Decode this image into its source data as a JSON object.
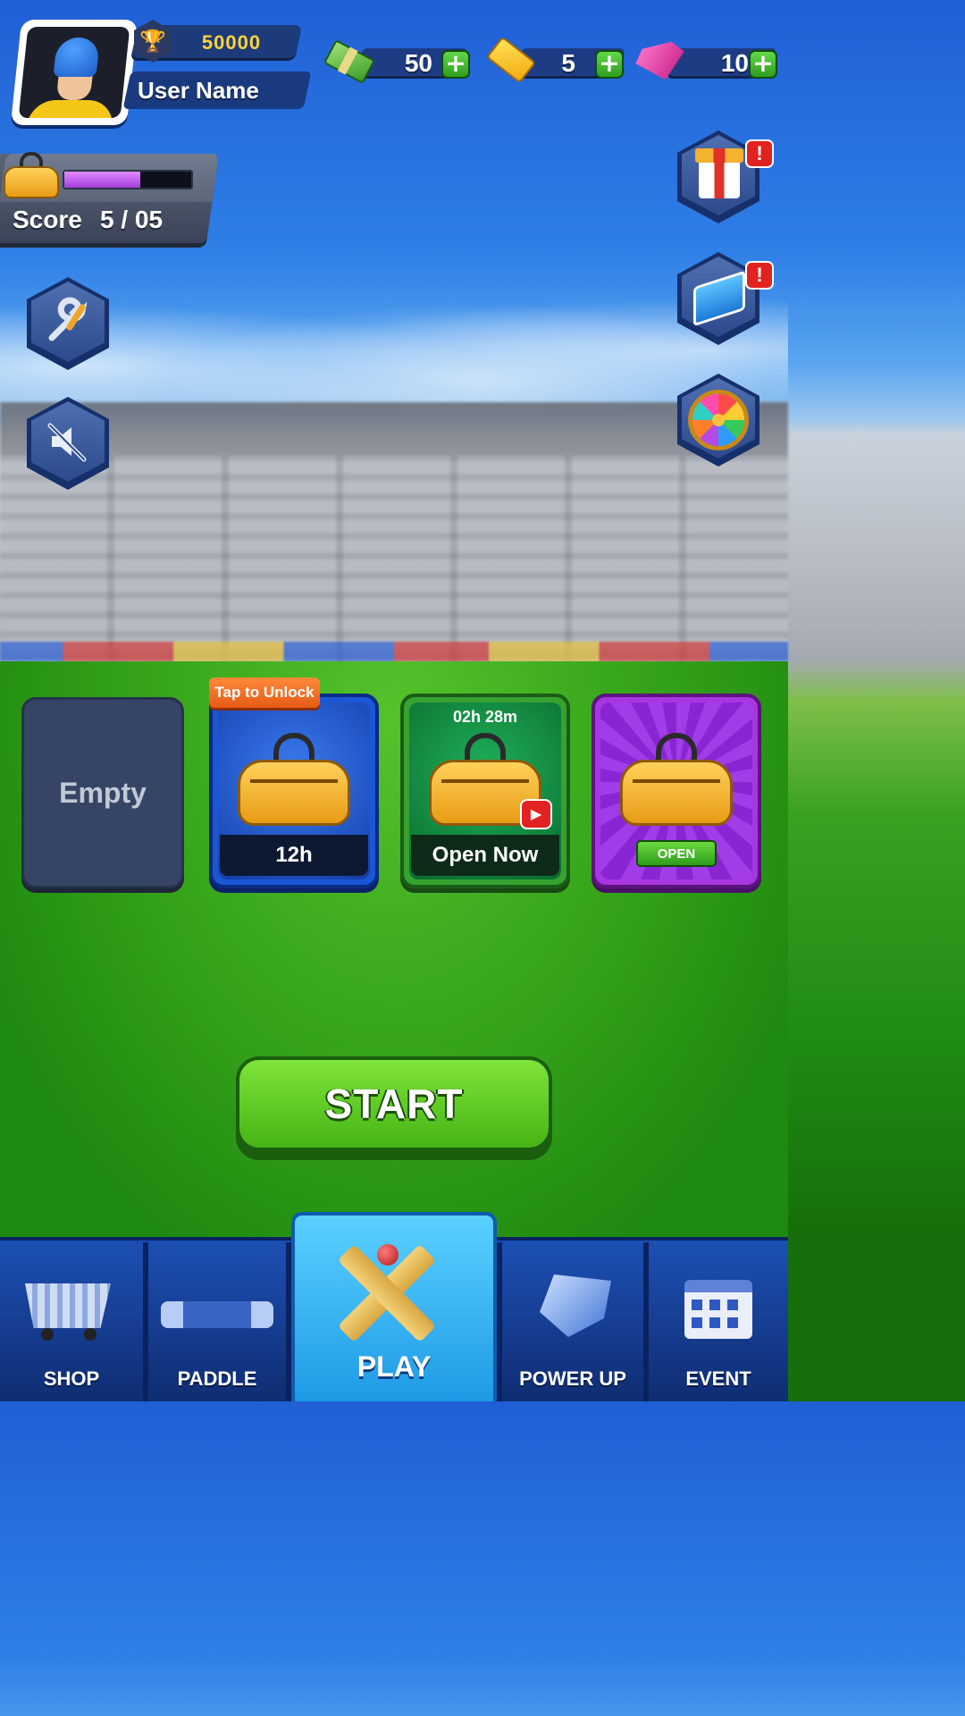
{
  "player": {
    "trophies": "50000",
    "username": "User Name",
    "avatar_icon": "cricketer-avatar"
  },
  "currencies": [
    {
      "name": "cash",
      "icon": "cash-icon",
      "amount": "50",
      "plus": "+"
    },
    {
      "name": "tickets",
      "icon": "ticket-icon",
      "amount": "5",
      "plus": "+"
    },
    {
      "name": "gems",
      "icon": "gem-icon",
      "amount": "10",
      "plus": "+"
    }
  ],
  "score_panel": {
    "label": "Score",
    "value": "5 / 05",
    "progress": 0.6,
    "progress_color": "#c25ff0"
  },
  "left_buttons": [
    {
      "name": "settings",
      "icon": "wrench-icon"
    },
    {
      "name": "sound",
      "icon": "mute-icon"
    }
  ],
  "right_buttons": [
    {
      "name": "gift",
      "icon": "gift-icon",
      "alert": "!"
    },
    {
      "name": "book",
      "icon": "book-icon",
      "alert": "!"
    },
    {
      "name": "spin-wheel",
      "icon": "wheel-icon"
    }
  ],
  "bag_slots": {
    "empty_label": "Empty",
    "locked": {
      "ribbon": "Tap to Unlock",
      "footer": "12h"
    },
    "timed": {
      "timer": "02h 28m",
      "footer": "Open Now"
    },
    "ready": {
      "button": "OPEN"
    }
  },
  "start_button": "START",
  "nav": {
    "shop": "SHOP",
    "paddle": "PADDLE",
    "play": "PLAY",
    "power_up": "POWER UP",
    "event": "EVENT"
  },
  "colors": {
    "nav_blue": "#1a4fb8",
    "play_tab": "#3bb8f5",
    "start_green": "#5ccc22",
    "alert_red": "#e1221f"
  }
}
